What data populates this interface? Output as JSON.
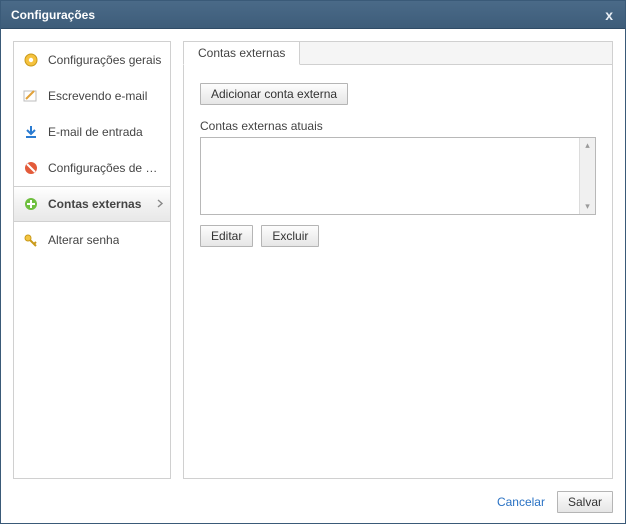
{
  "dialog": {
    "title": "Configurações",
    "close_glyph": "x"
  },
  "sidebar": {
    "items": [
      {
        "label": "Configurações gerais",
        "icon": "gear"
      },
      {
        "label": "Escrevendo e-mail",
        "icon": "compose"
      },
      {
        "label": "E-mail de entrada",
        "icon": "download"
      },
      {
        "label": "Configurações de spam",
        "icon": "block"
      },
      {
        "label": "Contas externas",
        "icon": "add"
      },
      {
        "label": "Alterar senha",
        "icon": "key"
      }
    ],
    "active_index": 4
  },
  "content": {
    "tab_label": "Contas externas",
    "add_button": "Adicionar conta externa",
    "list_label": "Contas externas atuais",
    "edit_button": "Editar",
    "delete_button": "Excluir"
  },
  "footer": {
    "cancel": "Cancelar",
    "save": "Salvar"
  }
}
